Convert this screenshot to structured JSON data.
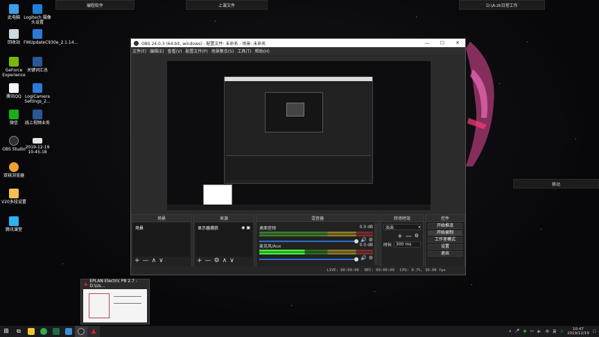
{
  "desktop": {
    "fences": [
      {
        "label": "编程软件"
      },
      {
        "label": "上课文件"
      },
      {
        "label": "D:\\A-zk日常工作"
      },
      {
        "label": "移动"
      }
    ],
    "icons": [
      {
        "label": "此电脑"
      },
      {
        "label": "Logitech 摄像头设置"
      },
      {
        "label": "回收站"
      },
      {
        "label": "FWUpdateC930e_2.1.14..."
      },
      {
        "label": "GeForce Experience"
      },
      {
        "label": "关键词汇总"
      },
      {
        "label": "腾讯QQ"
      },
      {
        "label": "LogiCamera Settings_2..."
      },
      {
        "label": "微信"
      },
      {
        "label": "线上视频业务"
      },
      {
        "label": "OBS Studio"
      },
      {
        "label": "2019-12-19 10-45-18"
      },
      {
        "label": "双核浏览器"
      },
      {
        "label": "V20多段设置"
      },
      {
        "label": "腾讯课堂"
      }
    ]
  },
  "obs": {
    "title": "OBS 24.0.3 (64-bit, windows) - 配置文件: 未命名 - 场景: 未命名",
    "window_controls": {
      "minimize": "—",
      "maximize": "☐",
      "close": "✕"
    },
    "menu": [
      "文件(F)",
      "编辑(E)",
      "查看(V)",
      "配置文件(P)",
      "场景集合(S)",
      "工具(T)",
      "帮助(H)"
    ],
    "docks": {
      "scenes": {
        "title": "场景",
        "items": [
          "场景"
        ]
      },
      "sources": {
        "title": "来源",
        "items": [
          "显示器捕获"
        ]
      },
      "mixer": {
        "title": "混音器",
        "channels": [
          {
            "name": "桌面音频",
            "db": "0.0 dB"
          },
          {
            "name": "麦克风/Aux",
            "db": "0.0 dB"
          }
        ]
      },
      "transitions": {
        "title": "转场特效",
        "selected": "淡出",
        "duration_label": "时长",
        "duration_value": "300 ms"
      },
      "controls": {
        "title": "控件",
        "buttons": [
          "开始推流",
          "开始录制",
          "工作室模式",
          "设置",
          "退出"
        ]
      }
    },
    "toolbar_symbols": {
      "add": "+",
      "remove": "—",
      "up": "∧",
      "down": "∨",
      "gear": "⚙"
    },
    "statusbar": {
      "live": "LIVE: 00:00:00",
      "rec": "REC: 00:00:00",
      "cpu": "CPU: 0.7%, 30.00 fps"
    }
  },
  "eplan_preview": {
    "title": "EPLAN Electric P8 2.7 - D:\\Us..."
  },
  "taskbar": {
    "time": "10:47",
    "date": "2019/12/19",
    "tray_text": [
      "中",
      "英"
    ]
  },
  "colors": {
    "obs_bg": "#2b2b2b",
    "meter_green": "#3ef03a",
    "slider_blue": "#2f6fd0",
    "art_pink": "#e94a9a"
  }
}
